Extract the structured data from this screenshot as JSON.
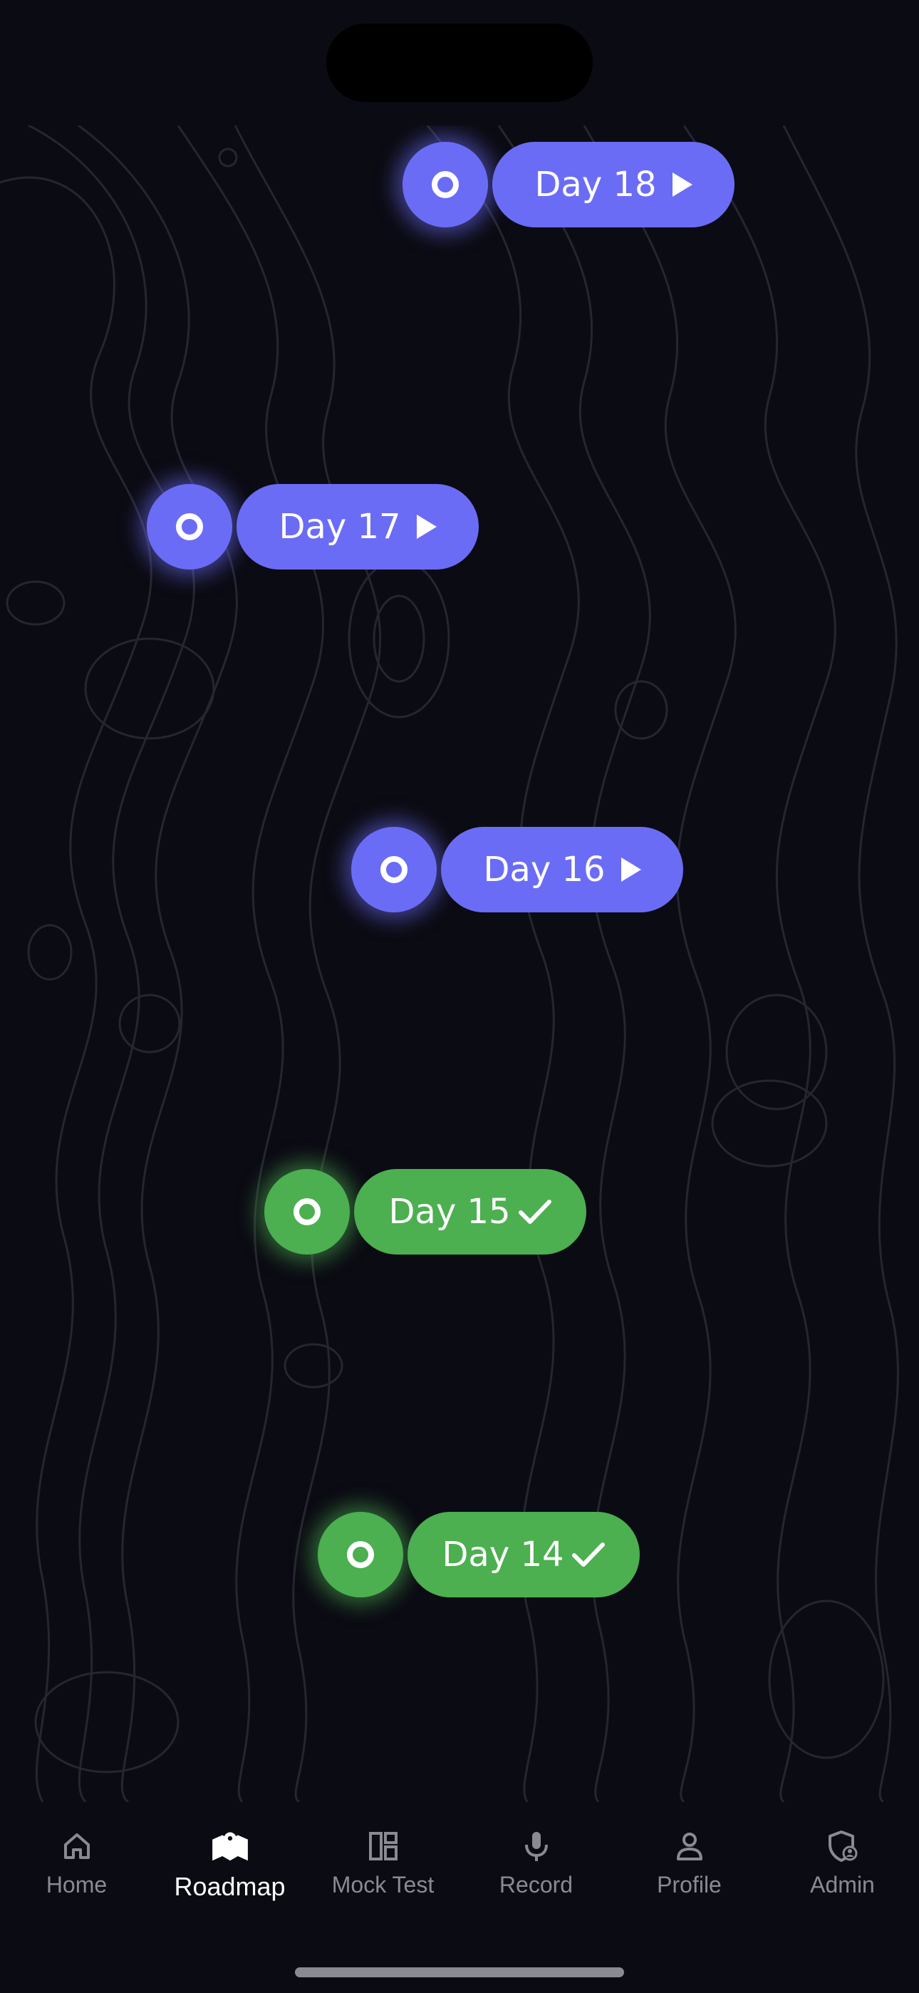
{
  "roadmap": {
    "days": [
      {
        "label": "Day 18",
        "status": "pending",
        "action": "play-icon"
      },
      {
        "label": "Day 17",
        "status": "pending",
        "action": "play-icon"
      },
      {
        "label": "Day 16",
        "status": "pending",
        "action": "play-icon"
      },
      {
        "label": "Day 15",
        "status": "completed",
        "action": "check-icon"
      },
      {
        "label": "Day 14",
        "status": "completed",
        "action": "check-icon"
      }
    ],
    "colors": {
      "pending": "#6b6cf6",
      "completed": "#4caf50",
      "background": "#0b0b13"
    }
  },
  "nav": {
    "active": "Roadmap",
    "items": [
      {
        "label": "Home",
        "icon": "home-icon"
      },
      {
        "label": "Roadmap",
        "icon": "map-icon"
      },
      {
        "label": "Mock Test",
        "icon": "layout-icon"
      },
      {
        "label": "Record",
        "icon": "mic-icon"
      },
      {
        "label": "Profile",
        "icon": "person-icon"
      },
      {
        "label": "Admin",
        "icon": "admin-shield-icon"
      }
    ]
  }
}
